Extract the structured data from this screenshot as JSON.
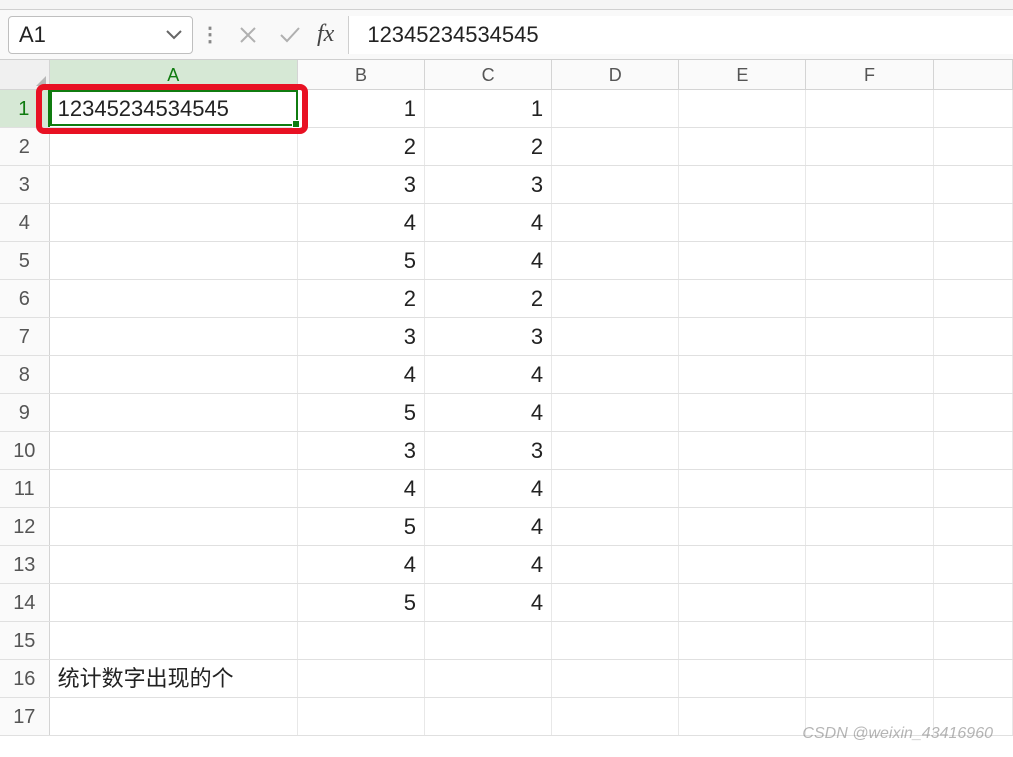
{
  "name_box": {
    "value": "A1"
  },
  "formula_bar": {
    "value": "12345234534545"
  },
  "columns": [
    "A",
    "B",
    "C",
    "D",
    "E",
    "F"
  ],
  "selected_col": "A",
  "selected_row": 1,
  "row_count": 17,
  "cells": {
    "A1": {
      "v": "12345234534545",
      "t": "txt"
    },
    "B1": {
      "v": "1",
      "t": "num"
    },
    "C1": {
      "v": "1",
      "t": "num"
    },
    "B2": {
      "v": "2",
      "t": "num"
    },
    "C2": {
      "v": "2",
      "t": "num"
    },
    "B3": {
      "v": "3",
      "t": "num"
    },
    "C3": {
      "v": "3",
      "t": "num"
    },
    "B4": {
      "v": "4",
      "t": "num"
    },
    "C4": {
      "v": "4",
      "t": "num"
    },
    "B5": {
      "v": "5",
      "t": "num"
    },
    "C5": {
      "v": "4",
      "t": "num"
    },
    "B6": {
      "v": "2",
      "t": "num"
    },
    "C6": {
      "v": "2",
      "t": "num"
    },
    "B7": {
      "v": "3",
      "t": "num"
    },
    "C7": {
      "v": "3",
      "t": "num"
    },
    "B8": {
      "v": "4",
      "t": "num"
    },
    "C8": {
      "v": "4",
      "t": "num"
    },
    "B9": {
      "v": "5",
      "t": "num"
    },
    "C9": {
      "v": "4",
      "t": "num"
    },
    "B10": {
      "v": "3",
      "t": "num"
    },
    "C10": {
      "v": "3",
      "t": "num"
    },
    "B11": {
      "v": "4",
      "t": "num"
    },
    "C11": {
      "v": "4",
      "t": "num"
    },
    "B12": {
      "v": "5",
      "t": "num"
    },
    "C12": {
      "v": "4",
      "t": "num"
    },
    "B13": {
      "v": "4",
      "t": "num"
    },
    "C13": {
      "v": "4",
      "t": "num"
    },
    "B14": {
      "v": "5",
      "t": "num"
    },
    "C14": {
      "v": "4",
      "t": "num"
    },
    "A16": {
      "v": "统计数字出现的个",
      "t": "txt"
    }
  },
  "watermark": "CSDN @weixin_43416960",
  "icons": {
    "cancel": "cancel-icon",
    "confirm": "confirm-icon",
    "fx": "fx-icon",
    "dropdown": "chevron-down-icon"
  },
  "highlight": {
    "cell": "A1"
  }
}
